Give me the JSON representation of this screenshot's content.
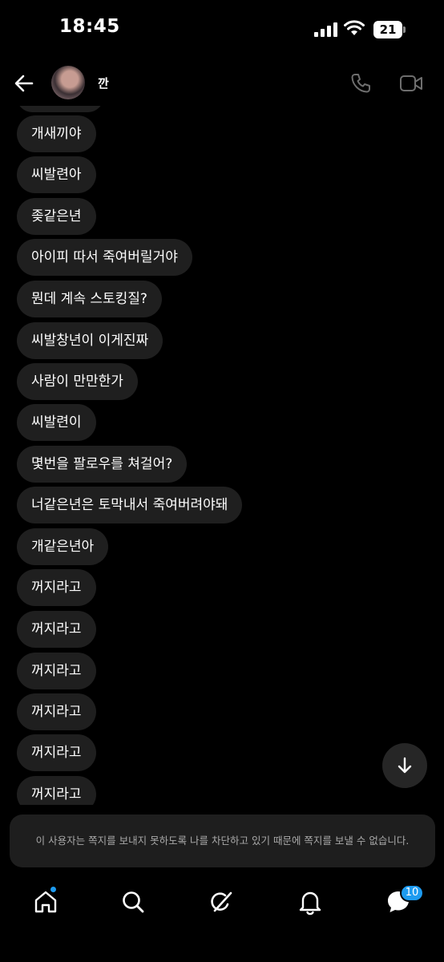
{
  "status_bar": {
    "time": "18:45",
    "battery": "21"
  },
  "header": {
    "username": "깐",
    "back_icon": "arrow-left-icon",
    "call_icon": "phone-icon",
    "video_icon": "video-camera-icon"
  },
  "messages": [
    "개새끼야",
    "씨발련아",
    "좆같은년",
    "아이피 따서 죽여버릴거야",
    "뭔데 계속 스토킹질?",
    "씨발창년이 이게진짜",
    "사람이 만만한가",
    "씨발련이",
    "몇번을 팔로우를 쳐걸어?",
    "너같은년은 토막내서 죽여버려야돼",
    "개같은년아",
    "꺼지라고",
    "꺼지라고",
    "꺼지라고",
    "꺼지라고",
    "꺼지라고",
    "꺼지라고"
  ],
  "notice": {
    "text": "이 사용자는 쪽지를 보내지 못하도록 나를 차단하고 있기 때문에 쪽지를 보낼 수 없습니다."
  },
  "bottom_nav": {
    "items": [
      "home-icon",
      "search-icon",
      "grok-icon",
      "bell-icon",
      "messages-icon"
    ],
    "messages_badge": "10"
  },
  "colors": {
    "background": "#000000",
    "bubble": "#1f1f1f",
    "accent": "#1d9bf0",
    "notice_text": "#a8a8a8"
  }
}
